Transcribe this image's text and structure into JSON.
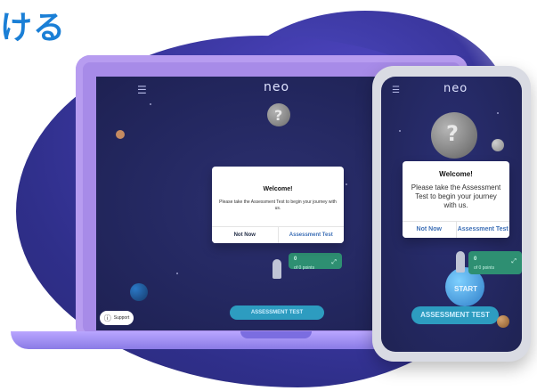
{
  "title_fragment": "ける",
  "app": {
    "logo_text": "neo",
    "menu_icon": "hamburger-icon"
  },
  "welcome_dialog": {
    "title": "Welcome!",
    "message_laptop": "Please take the Assessment Test to begin your journey with us.",
    "message_phone": "Please take the Assessment Test to begin your journey with us.",
    "not_now_label": "Not Now",
    "assessment_label": "Assessment Test"
  },
  "points_card": {
    "value": "0",
    "label": "of 0 points",
    "expand_icon": "expand-arrows-icon"
  },
  "cta": {
    "laptop_label": "ASSESSMENT TEST",
    "phone_label": "ASSESSMENT TEST"
  },
  "support": {
    "label": "Support",
    "icon": "question-circle-icon"
  },
  "phone": {
    "start_label": "START"
  },
  "colors": {
    "title_blue": "#1a7fd6",
    "background_blob": "#3f3aa8",
    "screen_bg": "#23275f",
    "modal_bg": "#ffffff",
    "cta_bg": "#2d9cc0",
    "points_card_bg": "#2e8f72",
    "laptop_lid": "#a78be8"
  }
}
